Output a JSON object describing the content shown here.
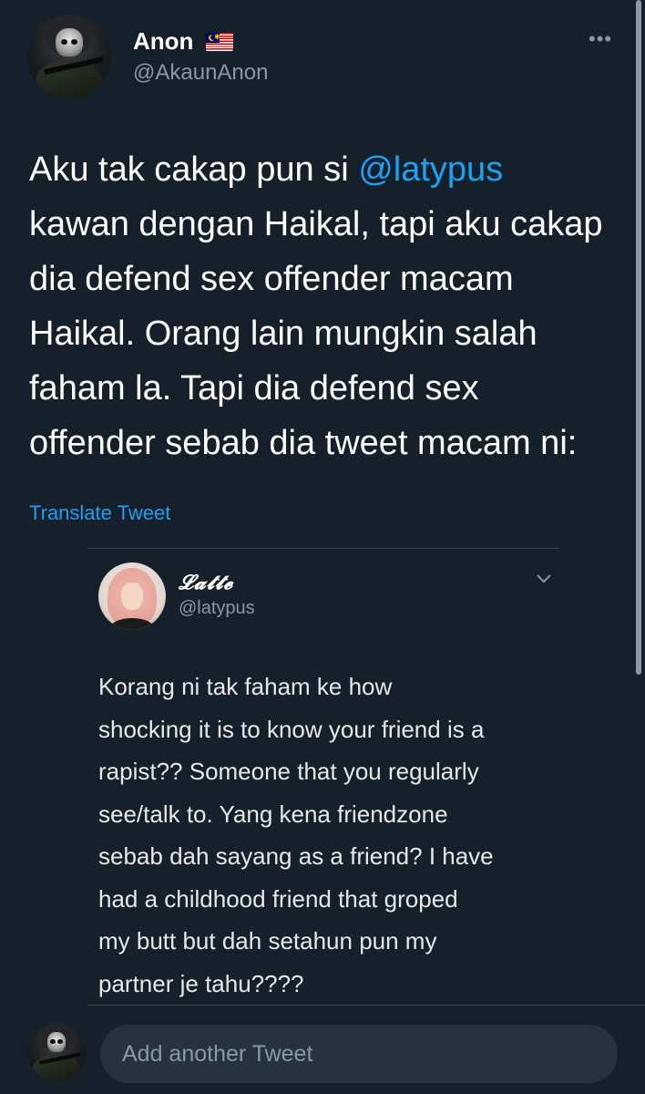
{
  "tweet": {
    "author": {
      "display_name": "Anon",
      "handle": "@AkaunAnon"
    },
    "text_lines": [
      {
        "prefix": "Aku tak cakap pun si ",
        "mention": "@latypus"
      },
      "kawan dengan Haikal, tapi aku cakap",
      "dia defend sex offender macam",
      "Haikal. Orang lain mungkin salah",
      "faham la. Tapi dia defend sex",
      "offender sebab dia tweet macam ni:"
    ],
    "translate_label": "Translate Tweet",
    "more_icon": "more-dots-icon"
  },
  "quoted": {
    "display_name": "𝓛𝓪𝓽𝓽𝓮",
    "handle": "@latypus",
    "text_lines": [
      "Korang ni tak faham ke how",
      "shocking it is to know your friend is a",
      "rapist?? Someone that you regularly",
      "see/talk to. Yang kena friendzone",
      "sebab dah sayang as a friend? I have",
      "had a childhood friend that groped",
      "my butt but dah setahun pun my",
      "partner je tahu????"
    ]
  },
  "reply": {
    "placeholder": "Add another Tweet"
  },
  "colors": {
    "background": "#15202b",
    "accent": "#1da1f2",
    "muted": "#8899a6",
    "input_bg": "#253341"
  }
}
